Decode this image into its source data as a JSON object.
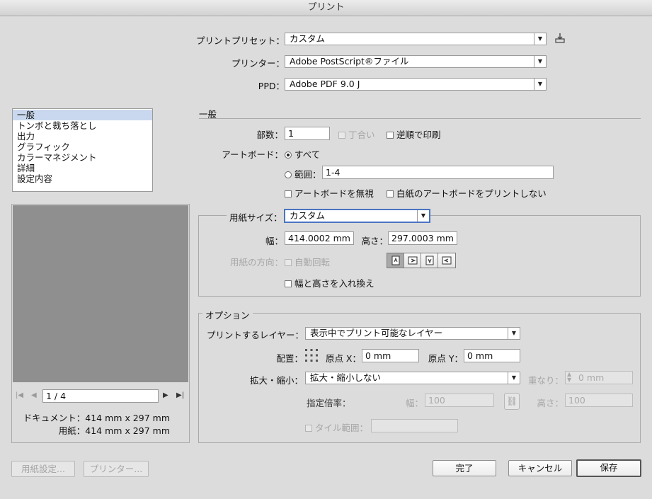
{
  "window": {
    "title": "プリント"
  },
  "top": {
    "preset_label": "プリントプリセット：",
    "preset_value": "カスタム",
    "printer_label": "プリンター：",
    "printer_value": "Adobe PostScript®ファイル",
    "ppd_label": "PPD：",
    "ppd_value": "Adobe PDF 9.0 J"
  },
  "sidebar": {
    "items": [
      {
        "label": "一般"
      },
      {
        "label": "トンボと裁ち落とし"
      },
      {
        "label": "出力"
      },
      {
        "label": "グラフィック"
      },
      {
        "label": "カラーマネジメント"
      },
      {
        "label": "詳細"
      },
      {
        "label": "設定内容"
      }
    ],
    "selected_index": 0
  },
  "preview": {
    "page_value": "1 / 4",
    "document_label": "ドキュメント：414 mm x 297 mm",
    "paper_label": "用紙：414 mm x 297 mm"
  },
  "general": {
    "section_title": "一般",
    "copies_label": "部数：",
    "copies_value": "1",
    "collate_label": "丁合い",
    "reverse_label": "逆順で印刷",
    "artboard_label": "アートボード：",
    "all_label": "すべて",
    "range_label": "範囲：",
    "range_value": "1-4",
    "ignore_artboards_label": "アートボードを無視",
    "skip_blank_label": "白紙のアートボードをプリントしない"
  },
  "paper": {
    "size_label": "用紙サイズ：",
    "size_value": "カスタム",
    "width_label": "幅：",
    "width_value": "414.0002 mm",
    "height_label": "高さ：",
    "height_value": "297.0003 mm",
    "orientation_label": "用紙の方向：",
    "auto_rotate_label": "自動回転",
    "transverse_label": "幅と高さを入れ換え"
  },
  "options": {
    "section_title": "オプション",
    "layers_label": "プリントするレイヤー：",
    "layers_value": "表示中でプリント可能なレイヤー",
    "placement_label": "配置：",
    "origin_x_label": "原点 X：",
    "origin_x_value": "0 mm",
    "origin_y_label": "原点 Y：",
    "origin_y_value": "0 mm",
    "scaling_label": "拡大・縮小：",
    "scaling_value": "拡大・縮小しない",
    "overlap_label": "重なり：",
    "overlap_value": "0 mm",
    "scale_label": "指定倍率：",
    "scale_width_label": "幅：",
    "scale_width_value": "100",
    "scale_height_label": "高さ：",
    "scale_height_value": "100",
    "tile_label": "タイル範囲："
  },
  "footer": {
    "page_setup": "用紙設定...",
    "printer": "プリンター...",
    "done": "完了",
    "cancel": "キャンセル",
    "save": "保存"
  }
}
